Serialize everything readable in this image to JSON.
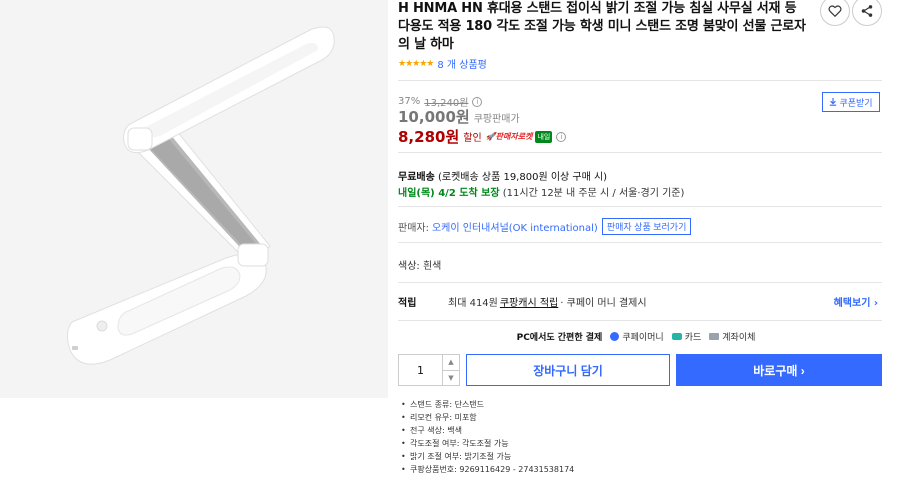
{
  "product": {
    "title": "H HNMA HN 휴대용 스탠드 접이식 밝기 조절 가능 침실 사무실 서재 등 다용도 적용 180 각도 조절 가능 학생 미니 스탠드 조명 붐맞이 선물 근로자의 날 하마",
    "rating_stars": "★★★★★",
    "review_count": "8 개 상품평"
  },
  "price": {
    "discount_pct": "37%",
    "original": "13,240원",
    "coupang_price": "10,000원",
    "coupang_label": "쿠팡판매가",
    "sale_price": "8,280원",
    "sale_label": "할인",
    "rocket_badge": "판매자로켓",
    "tomorrow_badge": "내일",
    "coupon_button": "쿠폰받기"
  },
  "shipping": {
    "free_label": "무료배송",
    "free_detail": "(로켓배송 상품 19,800원 이상 구매 시)",
    "arrival_date": "내일(목) 4/2 도착 보장",
    "arrival_detail": "(11시간 12분 내 주문 시 / 서울⋅경기 기준)"
  },
  "seller": {
    "label": "판매자:",
    "name": "오케이 인터내셔널(OK international)",
    "view_button": "판매자 상품 보러가기"
  },
  "option": {
    "color": "색상: 흰색"
  },
  "benefit": {
    "heading": "적립",
    "text_before": "최대 414원",
    "link": "쿠팡캐시 적립",
    "text_after": "· 쿠페이 머니 결제시",
    "more": "혜택보기 ›"
  },
  "payment": {
    "heading": "PC에서도 간편한 결제",
    "methods": [
      {
        "label": "쿠페이머니",
        "color": "#346aff"
      },
      {
        "label": "카드",
        "color": "#26b5a4"
      },
      {
        "label": "계좌이체",
        "color": "#9aa3ad"
      }
    ]
  },
  "purchase": {
    "quantity": "1",
    "up_arrow": "▲",
    "down_arrow": "▼",
    "cart_button": "장바구니 담기",
    "buy_button": "바로구매 ›"
  },
  "specs": [
    "스탠드 종류: 단스탠드",
    "리모컨 유무: 미포함",
    "전구 색상: 백색",
    "각도조절 여부: 각도조절 가능",
    "밝기 조절 여부: 밝기조절 가능",
    "쿠팡상품번호: 9269116429 - 27431538174"
  ],
  "colors": {
    "accent": "#346aff",
    "sale": "#ae0000",
    "delivery": "#00891a"
  }
}
